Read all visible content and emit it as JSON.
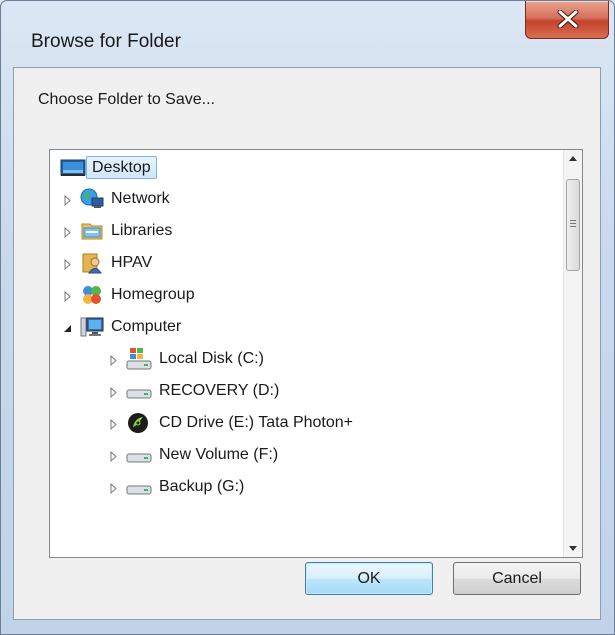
{
  "window": {
    "title": "Browse for Folder",
    "close_label": "X"
  },
  "dialog": {
    "prompt": "Choose Folder to Save...",
    "ok_label": "OK",
    "cancel_label": "Cancel"
  },
  "tree": {
    "items": [
      {
        "label": "Desktop",
        "icon": "desktop-icon",
        "state": "selected"
      },
      {
        "label": "Network",
        "icon": "network-icon",
        "state": "collapsed"
      },
      {
        "label": "Libraries",
        "icon": "libraries-icon",
        "state": "collapsed"
      },
      {
        "label": "HPAV",
        "icon": "user-folder-icon",
        "state": "collapsed"
      },
      {
        "label": "Homegroup",
        "icon": "homegroup-icon",
        "state": "collapsed"
      },
      {
        "label": "Computer",
        "icon": "computer-icon",
        "state": "expanded"
      },
      {
        "label": "Local Disk (C:)",
        "icon": "system-drive-icon",
        "state": "collapsed"
      },
      {
        "label": "RECOVERY (D:)",
        "icon": "drive-icon",
        "state": "collapsed"
      },
      {
        "label": "CD Drive (E:) Tata Photon+",
        "icon": "cd-drive-icon",
        "state": "collapsed"
      },
      {
        "label": "New Volume (F:)",
        "icon": "drive-icon",
        "state": "collapsed"
      },
      {
        "label": "Backup (G:)",
        "icon": "drive-icon",
        "state": "collapsed"
      }
    ]
  },
  "colors": {
    "selection": "#cfe6fb",
    "default_button": "#bee6fd",
    "close_button": "#c4432b"
  }
}
